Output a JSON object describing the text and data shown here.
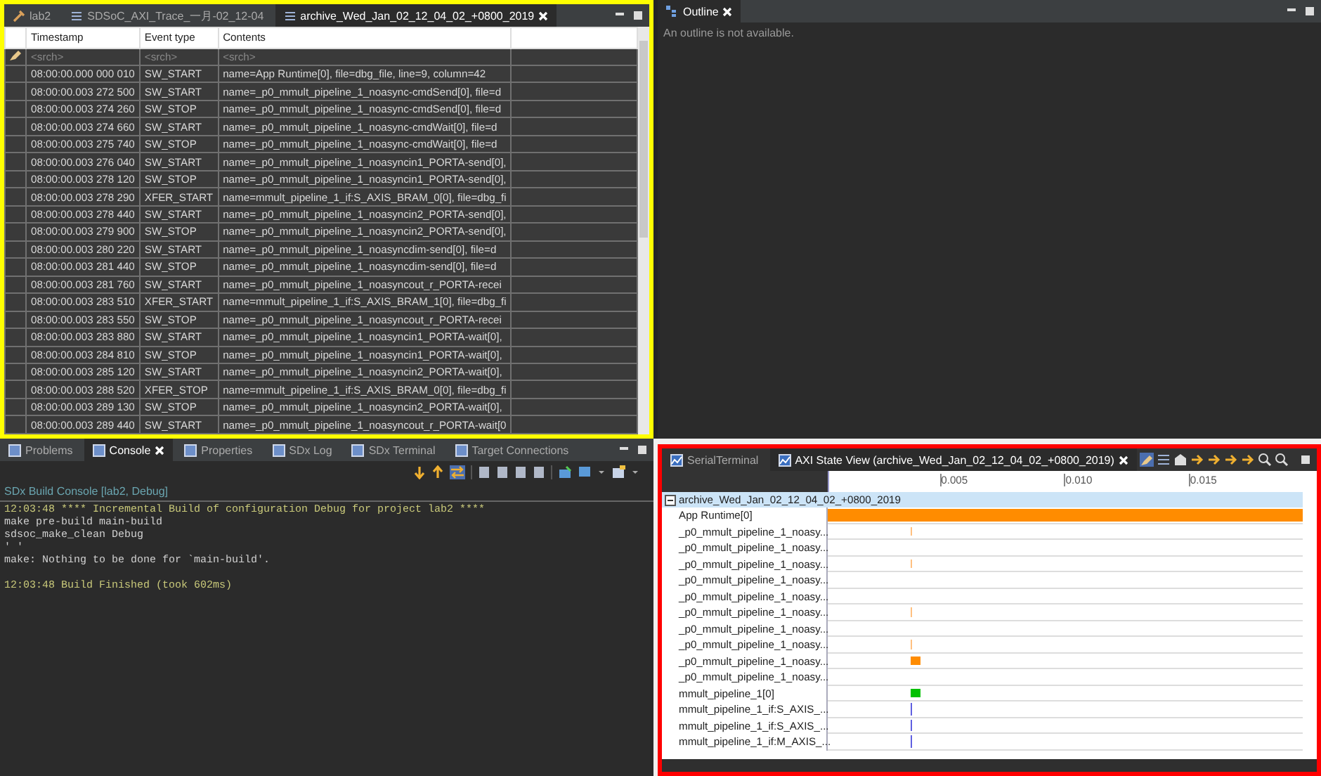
{
  "editor": {
    "tabs": [
      {
        "label": "lab2",
        "kind": "project",
        "selected": false,
        "closable": false
      },
      {
        "label": "SDSoC_AXI_Trace_一月-02_12-04",
        "kind": "trace",
        "selected": false,
        "closable": false
      },
      {
        "label": "archive_Wed_Jan_02_12_04_02_+0800_2019",
        "kind": "trace",
        "selected": true,
        "closable": true
      }
    ],
    "table": {
      "columns": [
        "Timestamp",
        "Event type",
        "Contents"
      ],
      "filters": [
        {
          "placeholder": "<srch>"
        },
        {
          "placeholder": "<srch>"
        },
        {
          "placeholder": "<srch>"
        }
      ],
      "rows": [
        {
          "time": "08:00:00.000 000 010",
          "event": "SW_START",
          "contents": "name=App Runtime[0], file=dbg_file, line=9, column=42"
        },
        {
          "time": "08:00:00.003 272 500",
          "event": "SW_START",
          "contents": "name=_p0_mmult_pipeline_1_noasync-cmdSend[0], file=d"
        },
        {
          "time": "08:00:00.003 274 260",
          "event": "SW_STOP",
          "contents": "name=_p0_mmult_pipeline_1_noasync-cmdSend[0], file=d"
        },
        {
          "time": "08:00:00.003 274 660",
          "event": "SW_START",
          "contents": "name=_p0_mmult_pipeline_1_noasync-cmdWait[0], file=d"
        },
        {
          "time": "08:00:00.003 275 740",
          "event": "SW_STOP",
          "contents": "name=_p0_mmult_pipeline_1_noasync-cmdWait[0], file=d"
        },
        {
          "time": "08:00:00.003 276 040",
          "event": "SW_START",
          "contents": "name=_p0_mmult_pipeline_1_noasyncin1_PORTA-send[0],"
        },
        {
          "time": "08:00:00.003 278 120",
          "event": "SW_STOP",
          "contents": "name=_p0_mmult_pipeline_1_noasyncin1_PORTA-send[0],"
        },
        {
          "time": "08:00:00.003 278 290",
          "event": "XFER_START",
          "contents": "name=mmult_pipeline_1_if:S_AXIS_BRAM_0[0], file=dbg_fi"
        },
        {
          "time": "08:00:00.003 278 440",
          "event": "SW_START",
          "contents": "name=_p0_mmult_pipeline_1_noasyncin2_PORTA-send[0],"
        },
        {
          "time": "08:00:00.003 279 900",
          "event": "SW_STOP",
          "contents": "name=_p0_mmult_pipeline_1_noasyncin2_PORTA-send[0],"
        },
        {
          "time": "08:00:00.003 280 220",
          "event": "SW_START",
          "contents": "name=_p0_mmult_pipeline_1_noasyncdim-send[0], file=d"
        },
        {
          "time": "08:00:00.003 281 440",
          "event": "SW_STOP",
          "contents": "name=_p0_mmult_pipeline_1_noasyncdim-send[0], file=d"
        },
        {
          "time": "08:00:00.003 281 760",
          "event": "SW_START",
          "contents": "name=_p0_mmult_pipeline_1_noasyncout_r_PORTA-recei"
        },
        {
          "time": "08:00:00.003 283 510",
          "event": "XFER_START",
          "contents": "name=mmult_pipeline_1_if:S_AXIS_BRAM_1[0], file=dbg_fi"
        },
        {
          "time": "08:00:00.003 283 550",
          "event": "SW_STOP",
          "contents": "name=_p0_mmult_pipeline_1_noasyncout_r_PORTA-recei"
        },
        {
          "time": "08:00:00.003 283 880",
          "event": "SW_START",
          "contents": "name=_p0_mmult_pipeline_1_noasyncin1_PORTA-wait[0],"
        },
        {
          "time": "08:00:00.003 284 810",
          "event": "SW_STOP",
          "contents": "name=_p0_mmult_pipeline_1_noasyncin1_PORTA-wait[0],"
        },
        {
          "time": "08:00:00.003 285 120",
          "event": "SW_START",
          "contents": "name=_p0_mmult_pipeline_1_noasyncin2_PORTA-wait[0],"
        },
        {
          "time": "08:00:00.003 288 520",
          "event": "XFER_STOP",
          "contents": "name=mmult_pipeline_1_if:S_AXIS_BRAM_0[0], file=dbg_fi"
        },
        {
          "time": "08:00:00.003 289 130",
          "event": "SW_STOP",
          "contents": "name=_p0_mmult_pipeline_1_noasyncin2_PORTA-wait[0],"
        },
        {
          "time": "08:00:00.003 289 440",
          "event": "SW_START",
          "contents": "name=_p0_mmult_pipeline_1_noasyncout_r_PORTA-wait[0"
        }
      ]
    }
  },
  "outline": {
    "tab": {
      "label": "Outline",
      "selected": true
    },
    "message": "An outline is not available."
  },
  "console_panel": {
    "tabs": [
      {
        "label": "Problems",
        "selected": false,
        "closable": false
      },
      {
        "label": "Console",
        "selected": true,
        "closable": true
      },
      {
        "label": "Properties",
        "selected": false,
        "closable": false
      },
      {
        "label": "SDx Log",
        "selected": false,
        "closable": false
      },
      {
        "label": "SDx Terminal",
        "selected": false,
        "closable": false
      },
      {
        "label": "Target Connections",
        "selected": false,
        "closable": false
      }
    ],
    "title": "SDx Build Console [lab2, Debug]",
    "lines": [
      {
        "text": "12:03:48 **** Incremental Build of configuration Debug for project lab2 ****",
        "kind": "status"
      },
      {
        "text": "make pre-build main-build",
        "kind": "output"
      },
      {
        "text": "sdsoc_make_clean Debug",
        "kind": "output"
      },
      {
        "text": "' '",
        "kind": "output"
      },
      {
        "text": "make: Nothing to be done for `main-build'.",
        "kind": "output"
      },
      {
        "kind": "blank"
      },
      {
        "text": "12:03:48 Build Finished (took 602ms)",
        "kind": "status"
      }
    ]
  },
  "state_view": {
    "tabs": [
      {
        "label": "SerialTerminal",
        "selected": false,
        "closable": false
      },
      {
        "label": "AXI State View (archive_Wed_Jan_02_12_04_02_+0800_2019)",
        "selected": true,
        "closable": true
      }
    ],
    "ticks": [
      "0.005",
      "0.010",
      "0.015"
    ],
    "tree": {
      "label": "archive_Wed_Jan_02_12_04_02_+0800_2019",
      "expanded": true,
      "children": [
        {
          "label": "App Runtime[0]",
          "kind": "bar",
          "color": "#ff8c00"
        },
        {
          "label": "_p0_mmult_pipeline_1_noasy...",
          "kind": "tick",
          "color": "#ffc080"
        },
        {
          "label": "_p0_mmult_pipeline_1_noasy...",
          "kind": "empty"
        },
        {
          "label": "_p0_mmult_pipeline_1_noasy...",
          "kind": "tick",
          "color": "#ffc080"
        },
        {
          "label": "_p0_mmult_pipeline_1_noasy...",
          "kind": "empty"
        },
        {
          "label": "_p0_mmult_pipeline_1_noasy...",
          "kind": "empty"
        },
        {
          "label": "_p0_mmult_pipeline_1_noasy...",
          "kind": "tick",
          "color": "#ffc080"
        },
        {
          "label": "_p0_mmult_pipeline_1_noasy...",
          "kind": "empty"
        },
        {
          "label": "_p0_mmult_pipeline_1_noasy...",
          "kind": "tick",
          "color": "#ffc080"
        },
        {
          "label": "_p0_mmult_pipeline_1_noasy...",
          "kind": "block",
          "color": "#ff8c00"
        },
        {
          "label": "_p0_mmult_pipeline_1_noasy...",
          "kind": "empty"
        },
        {
          "label": "mmult_pipeline_1[0]",
          "kind": "block",
          "color": "#00c000"
        },
        {
          "label": "mmult_pipeline_1_if:S_AXIS_...",
          "kind": "line",
          "color": "#6060e0"
        },
        {
          "label": "mmult_pipeline_1_if:S_AXIS_...",
          "kind": "line",
          "color": "#6060e0"
        },
        {
          "label": "mmult_pipeline_1_if:M_AXIS_...",
          "kind": "line",
          "color": "#6060e0"
        }
      ]
    }
  }
}
